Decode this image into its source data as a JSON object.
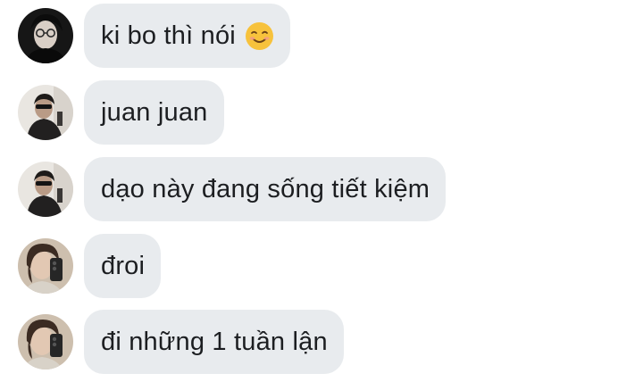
{
  "messages": [
    {
      "avatar": "avatar-person-glasses-dark",
      "text": "ki bo thì nói",
      "emoji": "smiling-face-emoji"
    },
    {
      "avatar": "avatar-person-sunglasses",
      "text": "juan juan"
    },
    {
      "avatar": "avatar-person-sunglasses",
      "text": "dạo này đang sống tiết kiệm"
    },
    {
      "avatar": "avatar-person-phone-mirror",
      "text": "đroi"
    },
    {
      "avatar": "avatar-person-phone-mirror",
      "text": "đi những 1 tuần lận"
    }
  ],
  "colors": {
    "bubble_background": "#e8ebee",
    "text": "#1c1e21",
    "page_background": "#ffffff"
  }
}
